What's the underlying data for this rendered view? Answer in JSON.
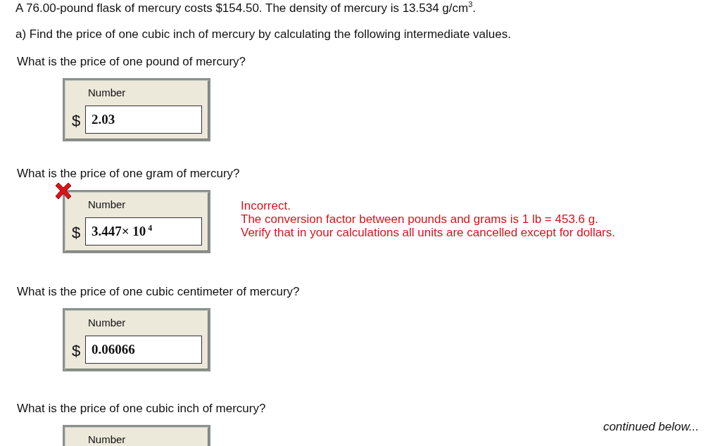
{
  "intro": "A 76.00-pound flask of mercury costs $154.50.  The density of mercury is 13.534 g/cm$^{3}$.",
  "part": "a) Find the price of one cubic inch of mercury by calculating the following intermediate values.",
  "questions": [
    {
      "question": "What is the price of one pound of mercury?",
      "label": "Number",
      "unit": "$",
      "value": "2.03",
      "incorrect": false
    },
    {
      "question": "What is the price of one gram of mercury?",
      "label": "Number",
      "unit": "$",
      "value": "3.447× 10$^{4}$",
      "incorrect": true,
      "feedback": [
        "Incorrect.",
        "The conversion factor between pounds and grams is 1 lb = 453.6 g.",
        "Verify that in your calculations all units are cancelled except for dollars."
      ]
    },
    {
      "question": "What is the price of one cubic centimeter of mercury?",
      "label": "Number",
      "unit": "$",
      "value": "0.06066",
      "incorrect": false
    },
    {
      "question": "What is the price of one cubic inch of mercury?",
      "label": "Number",
      "incorrect": false
    }
  ],
  "continued": "continued below..."
}
